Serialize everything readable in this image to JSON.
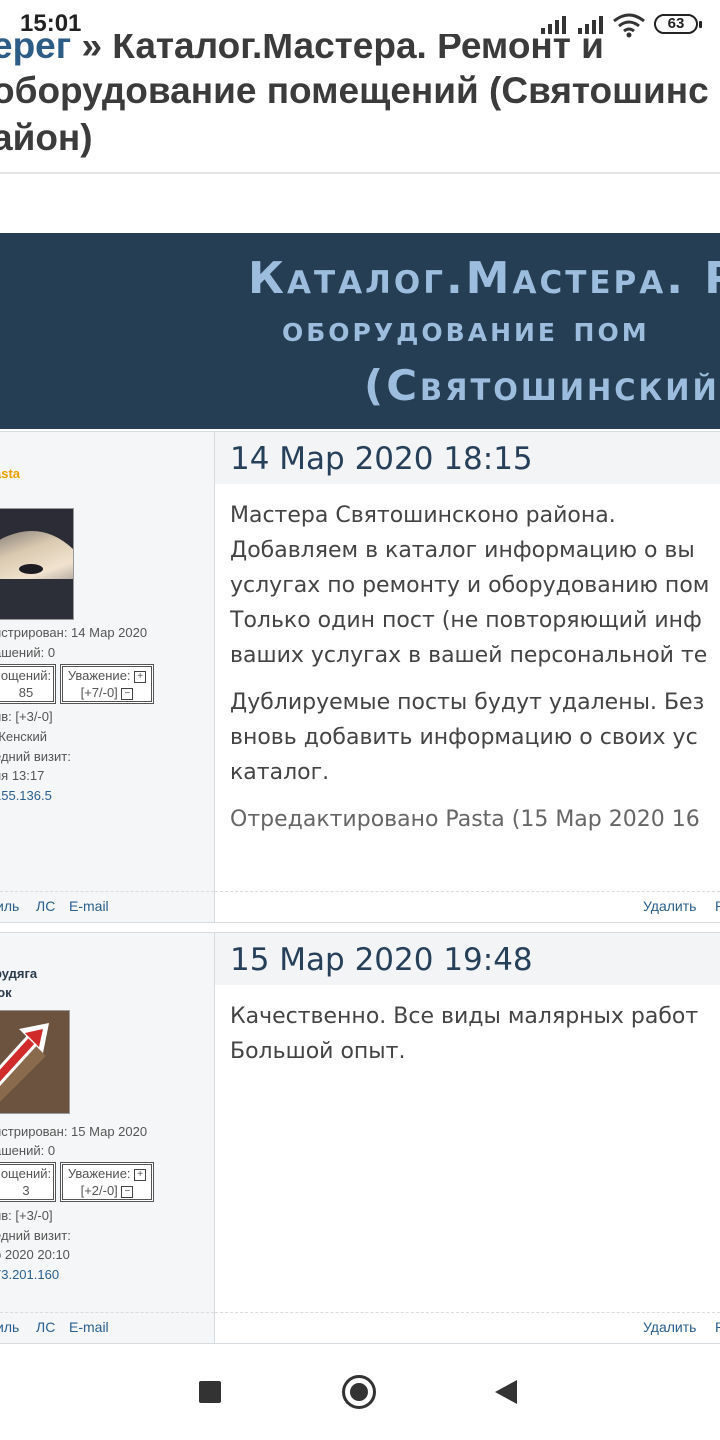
{
  "status_bar": {
    "time": "15:01",
    "battery": "63"
  },
  "page": {
    "title_line1_crumb": "ерег",
    "title_line1_rest": " » Каталог.Мастера. Ремонт и",
    "title_line2": "оборудование помещений (Святошинс",
    "title_line3": "айон)"
  },
  "header_band": {
    "line1": "Каталог.Мастера. Р",
    "line2": "оборудование пом",
    "line3": "(Святошинский"
  },
  "posts": [
    {
      "user": "asta",
      "date": "14 Мар 2020 18:15",
      "profile": {
        "registered": "истрирован: 14 Мар 2020",
        "warnings": "ашений: 0",
        "messages_label": "ощений:",
        "messages_value": "85",
        "respect_label": "Уважение:",
        "respect_value": "[+7/-0]",
        "positive": "ив: [+3/-0]",
        "gender": "Женский",
        "last_visit_label": "едний визит:",
        "last_visit_value": "ня 13:17",
        "ip": "155.136.5"
      },
      "body": [
        "Мастера Святошинсконо района.",
        "Добавляем в каталог информацию о вы",
        "услугах по ремонту и оборудованию пом",
        "Только один пост (не повторяющий инф",
        "ваших услугах в вашей персональной те"
      ],
      "body2": [
        "Дублируемые посты будут удалены. Без",
        "вновь добавить информацию о своих ус",
        "каталог."
      ],
      "edited": "Отредактировано Pasta (15 Мар 2020 16",
      "foot_left": {
        "profile": "иль",
        "pm": "ЛС",
        "email": "E-mail"
      },
      "foot_right": {
        "delete": "Удалить",
        "more": "Р"
      }
    },
    {
      "user_line1": "рудяга",
      "user_line2": "юк",
      "date": "15 Мар 2020 19:48",
      "profile": {
        "registered": "истрирован: 15 Мар 2020",
        "warnings": "ашений: 0",
        "messages_label": "ощений:",
        "messages_value": "3",
        "respect_label": "Уважение:",
        "respect_value": "[+2/-0]",
        "positive": "ив: [+3/-0]",
        "last_visit_label": "едний визит:",
        "last_visit_value": "р 2020 20:10",
        "ip": "73.201.160"
      },
      "body": [
        "Качественно. Все виды малярных работ",
        "Большой опыт."
      ],
      "foot_left": {
        "profile": "иль",
        "pm": "ЛС",
        "email": "E-mail"
      },
      "foot_right": {
        "delete": "Удалить",
        "more": "Р"
      }
    }
  ],
  "colors": {
    "header_band": "#263e53",
    "band_text": "#9cbddd",
    "link": "#2a5f8f",
    "username_highlight": "#e8a000"
  },
  "icons": [
    "signal-icon",
    "wifi-icon",
    "battery-icon",
    "nav-recent-icon",
    "nav-home-icon",
    "nav-back-icon"
  ]
}
